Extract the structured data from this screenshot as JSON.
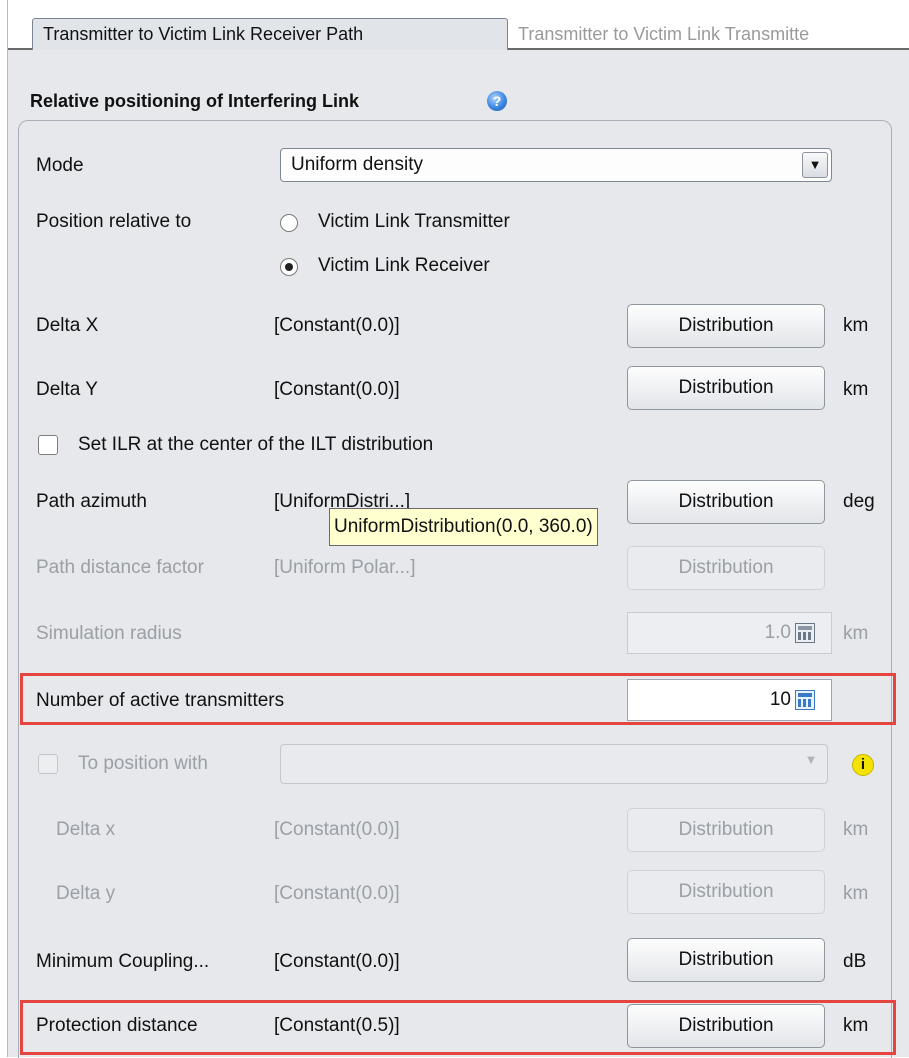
{
  "tabs": [
    {
      "label": "Transmitter to Victim Link Receiver Path",
      "active": true
    },
    {
      "label": "Transmitter to Victim Link Transmitte",
      "active": false
    }
  ],
  "panel": {
    "title": "Relative positioning of Interfering Link",
    "help_icon": "help-icon"
  },
  "mode": {
    "label": "Mode",
    "value": "Uniform density"
  },
  "position_relative": {
    "label": "Position relative to",
    "options": [
      {
        "label": "Victim Link Transmitter",
        "selected": false
      },
      {
        "label": "Victim Link Receiver",
        "selected": true
      }
    ]
  },
  "delta_x": {
    "label": "Delta X",
    "value": "[Constant(0.0)]",
    "button": "Distribution",
    "unit": "km"
  },
  "delta_y": {
    "label": "Delta Y",
    "value": "[Constant(0.0)]",
    "button": "Distribution",
    "unit": "km"
  },
  "set_ilr": {
    "label": "Set ILR at the center of the ILT distribution",
    "checked": false
  },
  "path_azimuth": {
    "label": "Path azimuth",
    "value": "[UniformDistri...]",
    "button": "Distribution",
    "unit": "deg",
    "tooltip": "UniformDistribution(0.0, 360.0)"
  },
  "path_distance": {
    "label": "Path distance factor",
    "value": "[Uniform Polar...]",
    "button": "Distribution"
  },
  "sim_radius": {
    "label": "Simulation radius",
    "value": "1.0",
    "unit": "km"
  },
  "active_tx": {
    "label": "Number of active transmitters",
    "value": "10"
  },
  "to_position": {
    "label": "To position with",
    "value": "",
    "info_icon": "info-icon"
  },
  "delta_x2": {
    "label": "Delta x",
    "value": "[Constant(0.0)]",
    "button": "Distribution",
    "unit": "km"
  },
  "delta_y2": {
    "label": "Delta y",
    "value": "[Constant(0.0)]",
    "button": "Distribution",
    "unit": "km"
  },
  "min_coupling": {
    "label": "Minimum Coupling...",
    "value": "[Constant(0.0)]",
    "button": "Distribution",
    "unit": "dB"
  },
  "protection": {
    "label": "Protection distance",
    "value": "[Constant(0.5)]",
    "button": "Distribution",
    "unit": "km"
  },
  "colors": {
    "highlight": "#e5453f",
    "tooltip_bg": "#ffffcf",
    "panel_bg": "#e6e8ec"
  }
}
